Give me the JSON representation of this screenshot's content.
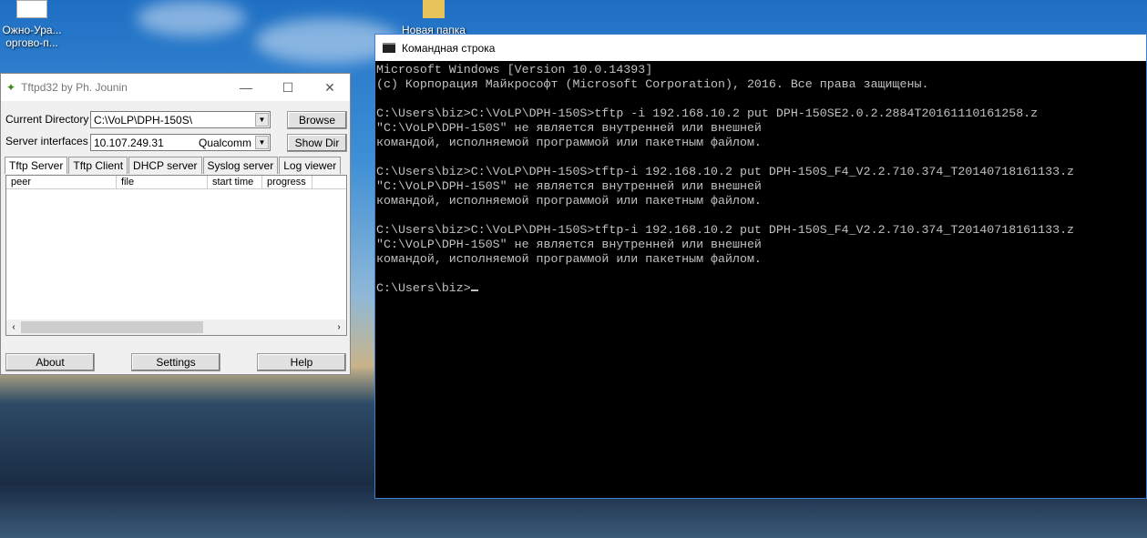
{
  "desktop": {
    "icons": [
      {
        "label_lines": [
          "Ожно-Ура...",
          "оргово-п..."
        ]
      },
      {
        "label": "Новая папка"
      }
    ]
  },
  "tftpd": {
    "title": "Tftpd32 by Ph. Jounin",
    "current_directory_label": "Current Directory",
    "current_directory_value": "C:\\VoLP\\DPH-150S\\",
    "server_interfaces_label": "Server interfaces",
    "server_interfaces_ip": "10.107.249.31",
    "server_interfaces_adapter": "Qualcomm",
    "browse_label": "Browse",
    "show_dir_label": "Show Dir",
    "tabs": [
      "Tftp Server",
      "Tftp Client",
      "DHCP server",
      "Syslog server",
      "Log viewer"
    ],
    "columns": [
      "peer",
      "file",
      "start time",
      "progress"
    ],
    "about_label": "About",
    "settings_label": "Settings",
    "help_label": "Help"
  },
  "cmd": {
    "title": "Командная строка",
    "lines": [
      "Microsoft Windows [Version 10.0.14393]",
      "(c) Корпорация Майкрософт (Microsoft Corporation), 2016. Все права защищены.",
      "",
      "C:\\Users\\biz>C:\\VoLP\\DPH-150S>tftp -i 192.168.10.2 put DPH-150SE2.0.2.2884T20161110161258.z",
      "\"C:\\VoLP\\DPH-150S\" не является внутренней или внешней",
      "командой, исполняемой программой или пакетным файлом.",
      "",
      "C:\\Users\\biz>C:\\VoLP\\DPH-150S>tftp-i 192.168.10.2 put DPH-150S_F4_V2.2.710.374_T20140718161133.z",
      "\"C:\\VoLP\\DPH-150S\" не является внутренней или внешней",
      "командой, исполняемой программой или пакетным файлом.",
      "",
      "C:\\Users\\biz>C:\\VoLP\\DPH-150S>tftp-i 192.168.10.2 put DPH-150S_F4_V2.2.710.374_T20140718161133.z",
      "\"C:\\VoLP\\DPH-150S\" не является внутренней или внешней",
      "командой, исполняемой программой или пакетным файлом.",
      ""
    ],
    "prompt": "C:\\Users\\biz>"
  }
}
